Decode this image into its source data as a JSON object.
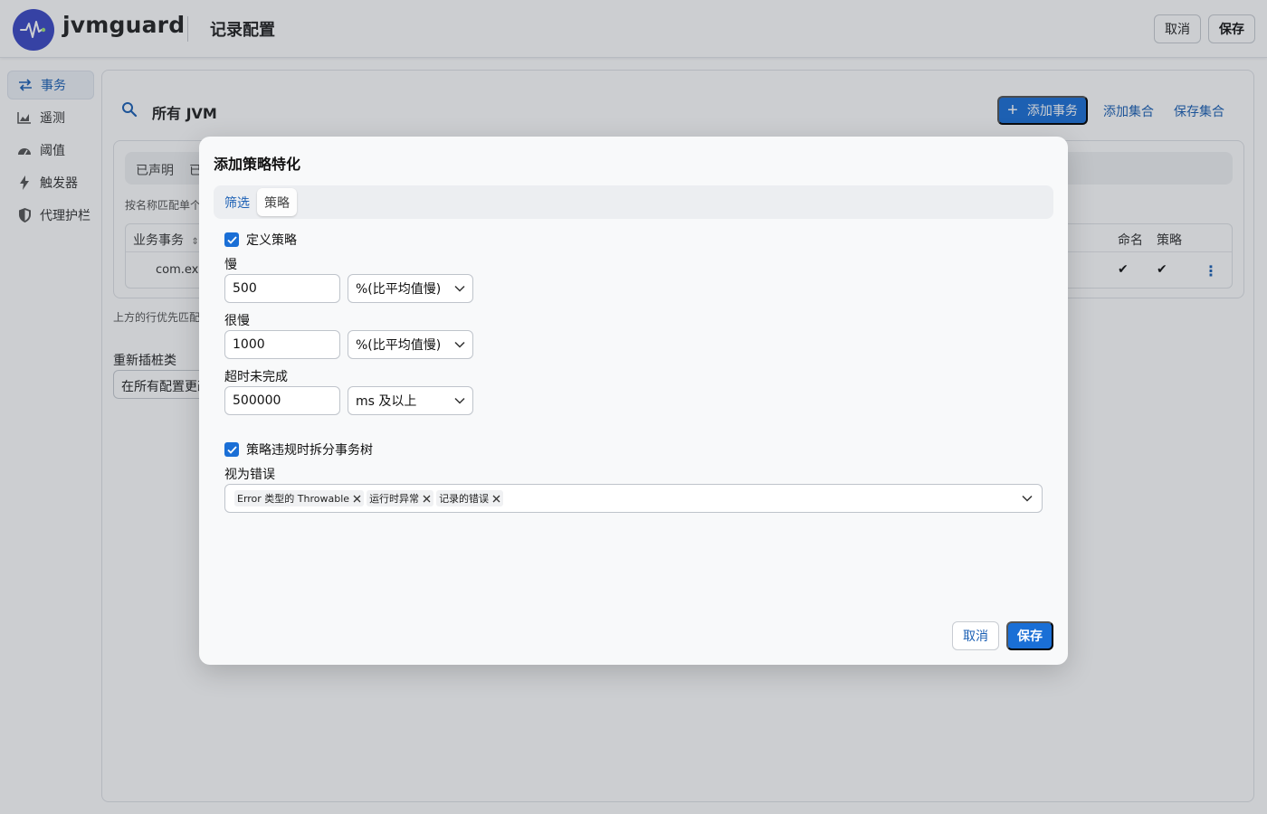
{
  "app": {
    "brand": "jvmguard",
    "page_title": "记录配置",
    "cancel_label": "取消",
    "save_label": "保存"
  },
  "sidebar": {
    "items": [
      {
        "label": "事务",
        "icon": "transactions-icon",
        "active": true
      },
      {
        "label": "遥测",
        "icon": "telemetry-icon",
        "active": false
      },
      {
        "label": "阈值",
        "icon": "gauge-icon",
        "active": false
      },
      {
        "label": "触发器",
        "icon": "bolt-icon",
        "active": false
      },
      {
        "label": "代理护栏",
        "icon": "shield-icon",
        "active": false
      }
    ]
  },
  "main": {
    "scope_title": "所有 JVM",
    "add_transaction_label": "添加事务",
    "add_set_label": "添加集合",
    "save_set_label": "保存集合",
    "segments": [
      "已声明",
      "已"
    ],
    "hint": "按名称匹配单个方",
    "table": {
      "headers": [
        "业务事务",
        "命名",
        "策略"
      ],
      "row_cell": "com.exa"
    },
    "note": "上方的行优先匹配。",
    "retransform_label": "重新插桩类",
    "retransform_value": "在所有配置更改"
  },
  "modal": {
    "title": "添加策略特化",
    "tabs": [
      {
        "label": "筛选",
        "selected": false
      },
      {
        "label": "策略",
        "selected": true
      }
    ],
    "define_policy_label": "定义策略",
    "define_policy_checked": true,
    "fields": [
      {
        "label": "慢",
        "value": "500",
        "unit": "%(比平均值慢)"
      },
      {
        "label": "很慢",
        "value": "1000",
        "unit": "%(比平均值慢)"
      },
      {
        "label": "超时未完成",
        "value": "500000",
        "unit": "ms 及以上"
      }
    ],
    "split_tree_label": "策略违规时拆分事务树",
    "split_tree_checked": true,
    "errors_label": "视为错误",
    "error_tags": [
      "Error 类型的 Throwable",
      "运行时异常",
      "记录的错误"
    ],
    "cancel_label": "取消",
    "save_label": "保存"
  },
  "colors": {
    "accent": "#1a6fd6",
    "link": "#1a5fb4",
    "logo": "#3b48c4"
  }
}
